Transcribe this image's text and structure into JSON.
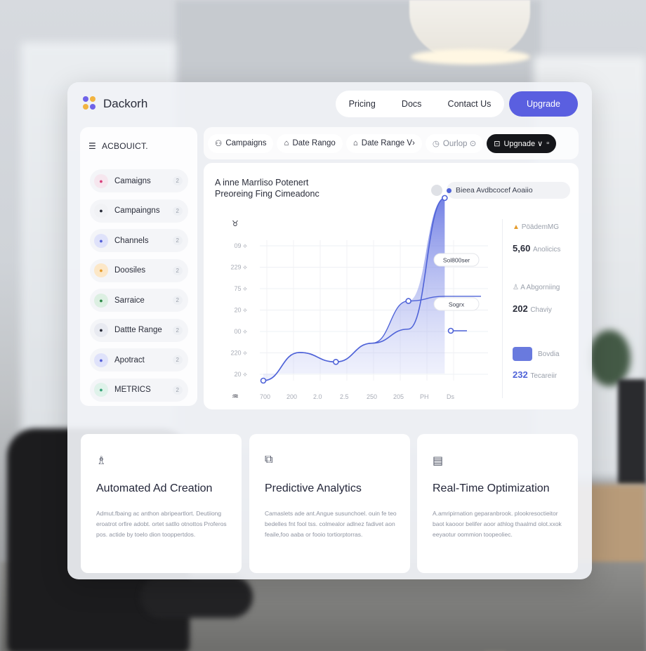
{
  "brand": {
    "name": "Dackorh"
  },
  "nav": {
    "items": [
      "Pricing",
      "Docs",
      "Contact Us"
    ],
    "upgrade_label": "Upgrade"
  },
  "sidebar": {
    "header": "ACBOUICT.",
    "items": [
      {
        "label": "Camaigns",
        "badge": "2",
        "color": "#f6e6ee",
        "dot": "#d9407c"
      },
      {
        "label": "Campaingns",
        "badge": "2",
        "color": "#f1f2f5",
        "dot": "#2a2d3a"
      },
      {
        "label": "Channels",
        "badge": "2",
        "color": "#dfe2fa",
        "dot": "#5561d8"
      },
      {
        "label": "Doosiles",
        "badge": "2",
        "color": "#fce7c7",
        "dot": "#e59c2d"
      },
      {
        "label": "Sarraice",
        "badge": "2",
        "color": "#dcefe2",
        "dot": "#2f8a4a"
      },
      {
        "label": "Dattte Range",
        "badge": "2",
        "color": "#e8eaf1",
        "dot": "#2a2d3a"
      },
      {
        "label": "Apotract",
        "badge": "2",
        "color": "#dfe2fa",
        "dot": "#5561d8"
      },
      {
        "label": "METRICS",
        "badge": "2",
        "color": "#dff2ea",
        "dot": "#3aa37a"
      }
    ]
  },
  "filters": {
    "chips": [
      "Campaigns",
      "Date Rango",
      "Date Range V›",
      "Ourlop ⊙"
    ],
    "upgrade": "Upgnade ∨"
  },
  "chart": {
    "title_line1": "A inne Marrliso Potenert",
    "title_line2": "Preoreing Fing Cimeadonc",
    "legend": "Bieea Avdbcocef Aoaiio",
    "tooltip1": "Sol800ser",
    "tooltip2": "Sogrx",
    "y_icon": "♉"
  },
  "chart_data": {
    "type": "area",
    "y_tick_labels": [
      "09",
      "229",
      "75",
      "20",
      "00",
      "220",
      "20"
    ],
    "x_tick_labels": [
      "700",
      "200",
      "2.0",
      "2.5",
      "250",
      "205",
      "PH",
      "Ds"
    ],
    "series": [
      {
        "values": [
          0,
          12,
          8,
          16,
          22,
          78,
          78
        ]
      },
      {
        "values": [
          0,
          12,
          8,
          16,
          34,
          36,
          36
        ]
      }
    ]
  },
  "stats": {
    "items": [
      {
        "label": "PöädemMG",
        "value": ""
      },
      {
        "label": "",
        "value": "5,60",
        "sub": "Anolicics"
      },
      {
        "label": "A Abgorniing",
        "value": ""
      },
      {
        "label": "",
        "value": "202",
        "sub": "Chaviy"
      },
      {
        "label": "Bovdia",
        "value": ""
      },
      {
        "label": "",
        "value": "232",
        "sub": "Tecareiir"
      }
    ]
  },
  "features": [
    {
      "title": "Automated Ad Creation",
      "icon": "♗",
      "text": "Admut.fbaing ac anthon abripeartlort. Deutiiong eroatrot orfire adobt. ortet satllo otnottos Proferos pos. actide by toelo dion tooppertdos."
    },
    {
      "title": "Predictive Analytics",
      "icon": "⧉",
      "text": "Camaslets ade ant.Angue susunchoel. ouin fe teo bedelles fnt fool tss. colmealor adlnez fadivet aon feaile,foo aaba or fooio tortiorptorras."
    },
    {
      "title": "Real-Time Optimization",
      "icon": "▤",
      "text": "A.amripirnation geparanbrook. plookresoctieitor baot kaooor belifer aoor athlog thaalmd olot.xxok eeyaotur oommion toopeoliec."
    }
  ]
}
